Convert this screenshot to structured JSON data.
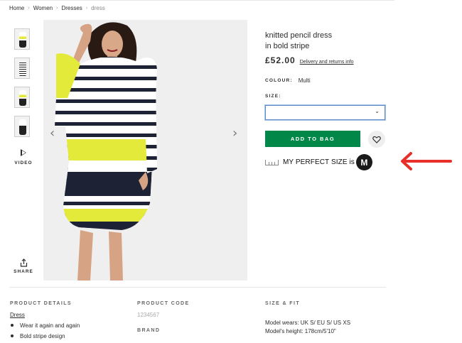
{
  "breadcrumb": {
    "home": "Home",
    "women": "Women",
    "dresses": "Dresses",
    "current": "dress"
  },
  "gallery": {
    "video_label": "VIDEO",
    "share_label": "SHARE"
  },
  "product": {
    "title_line1": "knitted pencil dress",
    "title_line2": "in bold stripe",
    "price": "£52.00",
    "delivery_link": "Delivery and returns info",
    "colour_label": "COLOUR:",
    "colour_value": "Multi",
    "size_label": "SIZE:",
    "size_value": "",
    "add_to_bag": "ADD TO BAG",
    "my_perfect_size_text": "MY PERFECT SIZE is",
    "my_perfect_size_value": "M"
  },
  "details": {
    "product_details_heading": "PRODUCT DETAILS",
    "category_link": "Dress",
    "bullets": [
      "Wear it again and again",
      "Bold stripe design"
    ],
    "product_code_heading": "PRODUCT CODE",
    "product_code": "1234567",
    "brand_heading": "BRAND",
    "size_fit_heading": "SIZE & FIT",
    "model_wears": "Model wears: UK S/ EU S/ US XS",
    "model_height": "Model's height: 178cm/5'10\""
  },
  "colors": {
    "add_to_bag_bg": "#018849",
    "annotation_arrow": "#e8302b",
    "stripe_yellow": "#e4ea3a",
    "stripe_navy": "#1d2235"
  }
}
